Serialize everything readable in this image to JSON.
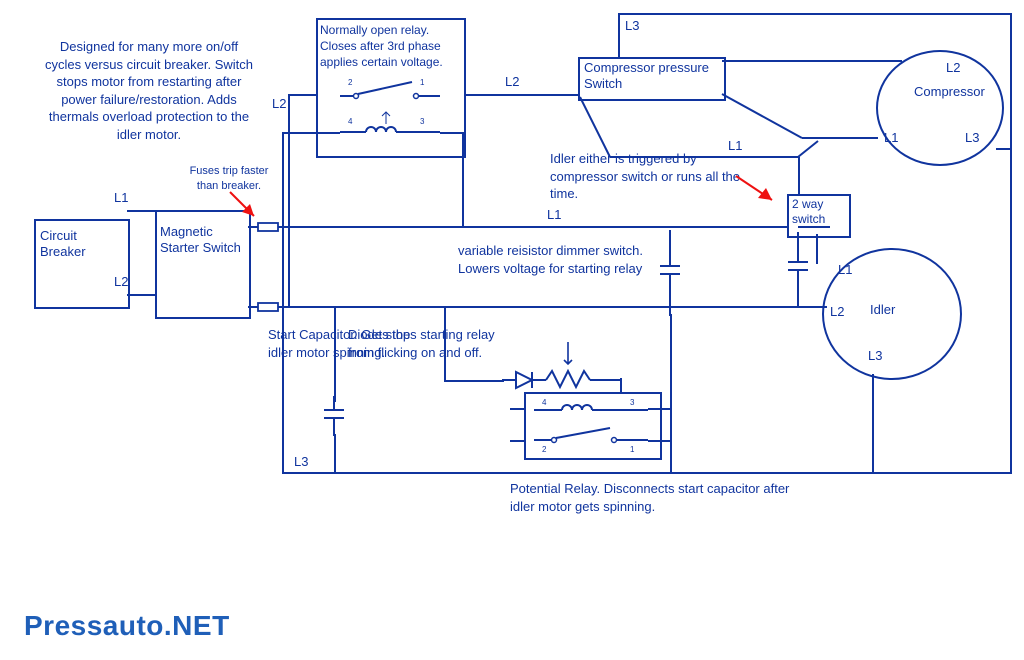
{
  "annotations": {
    "designed": "Designed for many more on/off cycles versus circuit breaker. Switch stops motor from restarting after power failure/restoration. Adds thermals overload protection to the idler motor.",
    "fuses": "Fuses trip faster than breaker.",
    "relay_top": "Normally open relay. Closes after 3rd phase applies certain voltage.",
    "idler_note": "Idler either is triggered by compressor switch or runs all the time.",
    "dimmer": "variable reisistor dimmer switch. Lowers voltage for starting relay",
    "start_cap": "Start Capacitor. Gets the idler motor spinning.",
    "diode": "Diode stops starting relay from flicking on and off.",
    "potential_relay": "Potential Relay. Disconnects start capacitor after idler motor gets spinning."
  },
  "components": {
    "circuit_breaker": "Circuit Breaker",
    "magnetic_starter": "Magnetic Starter Switch",
    "compressor_switch": "Compressor pressure Switch",
    "two_way_switch": "2 way switch",
    "compressor": "Compressor",
    "idler": "Idler"
  },
  "labels": {
    "L1": "L1",
    "L2": "L2",
    "L3": "L3"
  },
  "watermark": "Pressauto.NET"
}
